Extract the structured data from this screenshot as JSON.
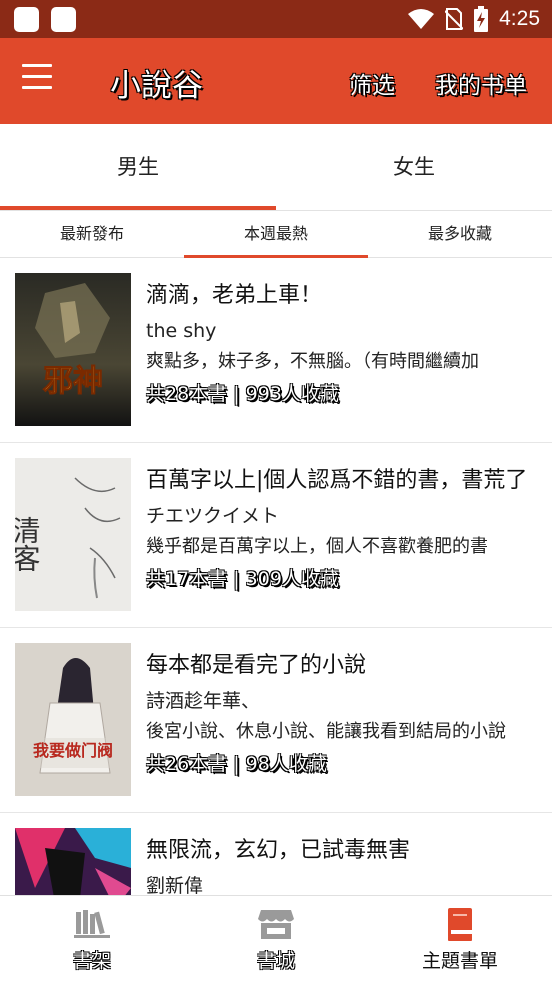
{
  "status_bar": {
    "time": "4:25",
    "icons": [
      "wifi-icon",
      "no-sim-icon",
      "battery-charging-icon"
    ]
  },
  "app_bar": {
    "title": "小說谷",
    "filter_label": "筛选",
    "my_booklist_label": "我的书单"
  },
  "gender_tabs": [
    {
      "label": "男生",
      "active": true
    },
    {
      "label": "女生",
      "active": false
    }
  ],
  "sort_tabs": [
    {
      "label": "最新發布",
      "active": false
    },
    {
      "label": "本週最熱",
      "active": true
    },
    {
      "label": "最多收藏",
      "active": false
    }
  ],
  "booklists": [
    {
      "title": "滴滴，老弟上車！",
      "author": "the shy",
      "desc": "爽點多，妹子多，不無腦。（有時間繼續加",
      "stats": "共28本書 | 993人收藏",
      "cover_text": "邪神"
    },
    {
      "title": "百萬字以上|個人認爲不錯的書，書荒了",
      "author": "チエツクイメト",
      "desc": "幾乎都是百萬字以上，個人不喜歡養肥的書",
      "stats": "共17本書 | 309人收藏",
      "cover_text": "清客"
    },
    {
      "title": "每本都是看完了的小說",
      "author": "詩酒趁年華、",
      "desc": "後宮小說、休息小說、能讓我看到結局的小說",
      "stats": "共26本書 | 98人收藏",
      "cover_text": "我要做门阀"
    },
    {
      "title": "無限流，玄幻，已試毒無害",
      "author": "劉新偉",
      "desc": "",
      "stats": "",
      "cover_text": ""
    }
  ],
  "bottom_nav": [
    {
      "label": "書架",
      "icon": "bookshelf-icon",
      "active": false
    },
    {
      "label": "書城",
      "icon": "store-icon",
      "active": false
    },
    {
      "label": "主題書單",
      "icon": "booklist-icon",
      "active": true
    }
  ],
  "colors": {
    "accent": "#e0492b",
    "status_bar": "#8b2a16"
  }
}
